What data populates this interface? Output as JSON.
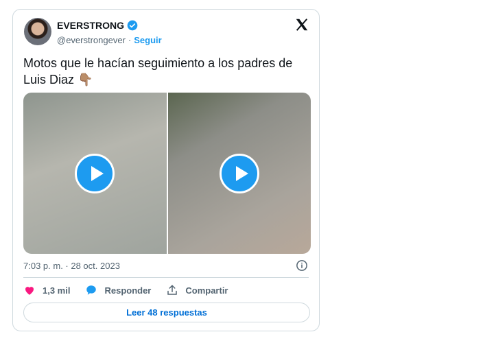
{
  "author": {
    "display_name": "EVERSTRONG",
    "handle": "@everstrongever",
    "separator": "·",
    "follow_label": "Seguir",
    "verified_color": "#1d9bf0"
  },
  "tweet": {
    "text": "Motos que le hacían seguimiento a los padres de Luis Diaz 👇🏽",
    "timestamp": "7:03 p. m. · 28 oct. 2023"
  },
  "media": {
    "items": [
      {
        "type": "video",
        "description_icon": "play-icon"
      },
      {
        "type": "video",
        "description_icon": "play-icon"
      }
    ]
  },
  "actions": {
    "like_count": "1,3 mil",
    "reply_label": "Responder",
    "share_label": "Compartir"
  },
  "footer": {
    "read_replies_label": "Leer 48 respuestas"
  },
  "colors": {
    "accent": "#1d9bf0",
    "like": "#f91880",
    "link": "#006fd6"
  }
}
